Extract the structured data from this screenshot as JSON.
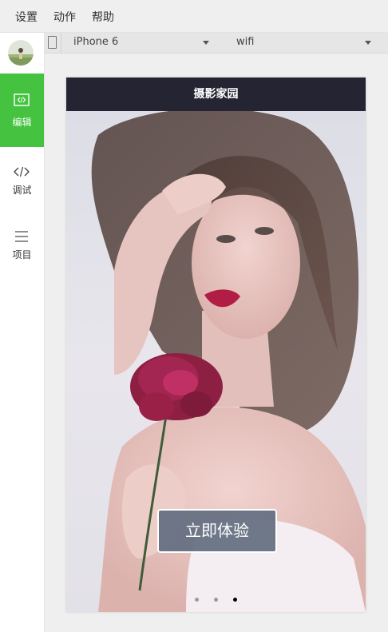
{
  "menu": {
    "settings": "设置",
    "actions": "动作",
    "help": "帮助"
  },
  "sidebar": {
    "items": [
      {
        "label": "编辑",
        "icon": "code-box-icon",
        "active": true
      },
      {
        "label": "调试",
        "icon": "code-icon",
        "active": false
      },
      {
        "label": "项目",
        "icon": "menu-icon",
        "active": false
      }
    ]
  },
  "device_bar": {
    "device": "iPhone 6",
    "network": "wifi"
  },
  "preview": {
    "title": "摄影家园",
    "cta_label": "立即体验",
    "pager": {
      "count": 3,
      "active_index": 2
    }
  },
  "colors": {
    "accent": "#45c340",
    "header_bg": "#252432",
    "cta_bg": "#626e80"
  }
}
